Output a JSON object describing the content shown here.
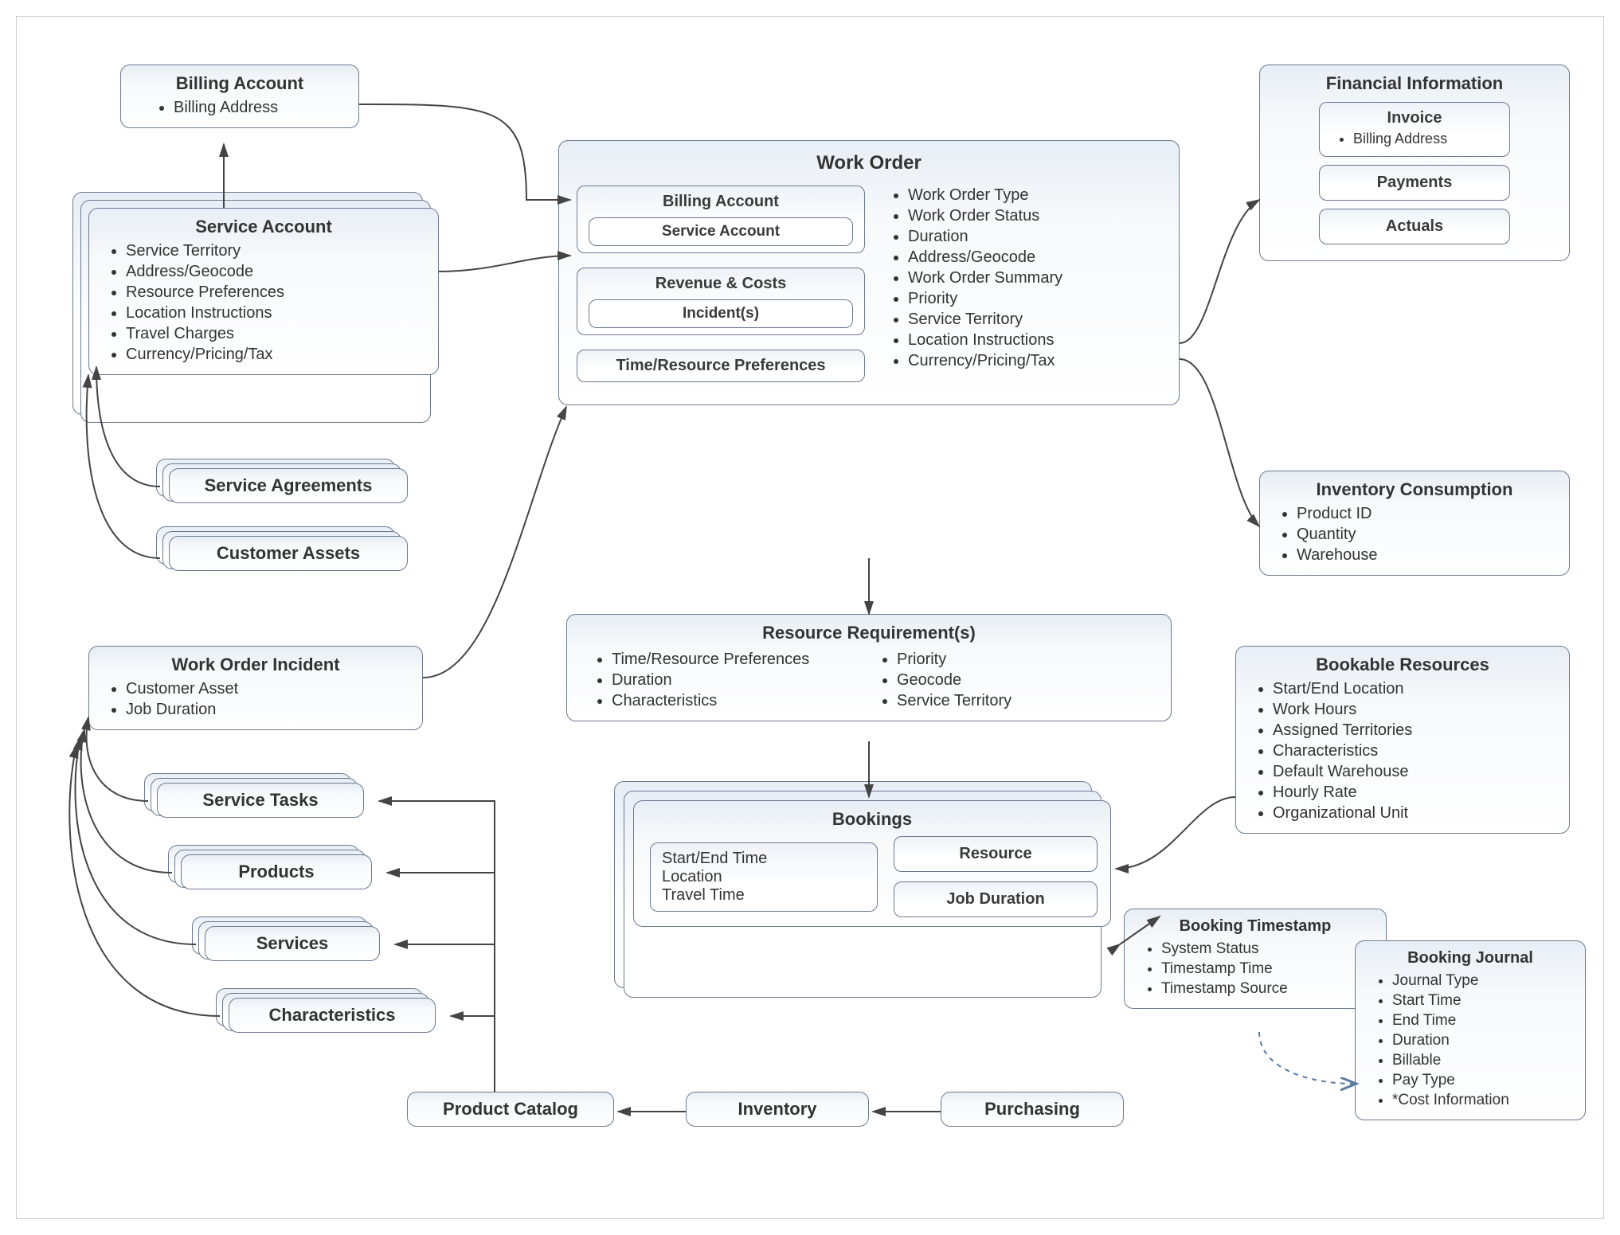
{
  "billingAccount": {
    "title": "Billing Account",
    "items": [
      "Billing Address"
    ]
  },
  "serviceAccount": {
    "title": "Service Account",
    "items": [
      "Service Territory",
      "Address/Geocode",
      "Resource Preferences",
      "Location Instructions",
      "Travel Charges",
      "Currency/Pricing/Tax"
    ]
  },
  "serviceAgreements": {
    "title": "Service Agreements"
  },
  "customerAssets": {
    "title": "Customer Assets"
  },
  "workOrder": {
    "title": "Work Order",
    "billingAccount": {
      "title": "Billing Account",
      "serviceAccount": "Service Account"
    },
    "revenueCosts": {
      "title": "Revenue & Costs",
      "incidents": "Incident(s)"
    },
    "timeResource": {
      "title": "Time/Resource Preferences"
    },
    "attrs": [
      "Work Order Type",
      "Work Order Status",
      "Duration",
      "Address/Geocode",
      "Work Order Summary",
      "Priority",
      "Service Territory",
      "Location Instructions",
      "Currency/Pricing/Tax"
    ]
  },
  "financial": {
    "title": "Financial Information",
    "invoice": {
      "title": "Invoice",
      "items": [
        "Billing Address"
      ]
    },
    "payments": "Payments",
    "actuals": "Actuals"
  },
  "inventoryConsumption": {
    "title": "Inventory Consumption",
    "items": [
      "Product ID",
      "Quantity",
      "Warehouse"
    ]
  },
  "workOrderIncident": {
    "title": "Work Order Incident",
    "items": [
      "Customer Asset",
      "Job Duration"
    ]
  },
  "serviceTasks": {
    "title": "Service Tasks"
  },
  "products": {
    "title": "Products"
  },
  "services": {
    "title": "Services"
  },
  "characteristics": {
    "title": "Characteristics"
  },
  "resourceReq": {
    "title": "Resource Requirement(s)",
    "left": [
      "Time/Resource Preferences",
      "Duration",
      "Characteristics"
    ],
    "right": [
      "Priority",
      "Geocode",
      "Service Territory"
    ]
  },
  "bookings": {
    "title": "Bookings",
    "details": [
      "Start/End Time",
      "Location",
      "Travel Time"
    ],
    "resource": "Resource",
    "jobDuration": "Job Duration"
  },
  "bookableResources": {
    "title": "Bookable Resources",
    "items": [
      "Start/End Location",
      "Work Hours",
      "Assigned Territories",
      "Characteristics",
      "Default Warehouse",
      "Hourly Rate",
      "Organizational Unit"
    ]
  },
  "bookingTimestamp": {
    "title": "Booking Timestamp",
    "items": [
      "System Status",
      "Timestamp Time",
      "Timestamp Source"
    ]
  },
  "bookingJournal": {
    "title": "Booking Journal",
    "items": [
      "Journal Type",
      "Start Time",
      "End Time",
      "Duration",
      "Billable",
      "Pay Type",
      "*Cost Information"
    ]
  },
  "productCatalog": "Product Catalog",
  "inventory": "Inventory",
  "purchasing": "Purchasing"
}
